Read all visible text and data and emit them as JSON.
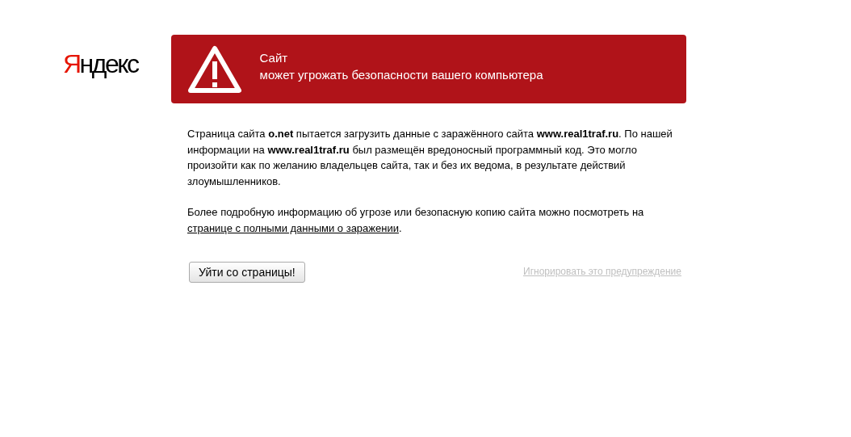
{
  "logo": {
    "first_letter": "Я",
    "rest": "ндекс"
  },
  "warning": {
    "line_1": "Сайт",
    "line_2": "может угрожать безопасности вашего компьютера"
  },
  "paragraphs": [
    {
      "text": "Страница сайта **o.net** пытается загрузить данные с заражённого сайта **www.real1traf.ru**. По нашей информации на **www.real1traf.ru** был размещён вредоносный программный код. Это могло произойти как по желанию владельцев сайта, так и без их ведома, в результате действий злоумышленников."
    },
    {
      "text": "Более подробную информацию об угрозе или безопасную копию сайта можно посмотреть на",
      "link": "странице с полными данными о заражении",
      "after": "."
    }
  ],
  "leave_button": "Уйти со страницы!",
  "ignore_link": "Игнорировать это предупреждение"
}
